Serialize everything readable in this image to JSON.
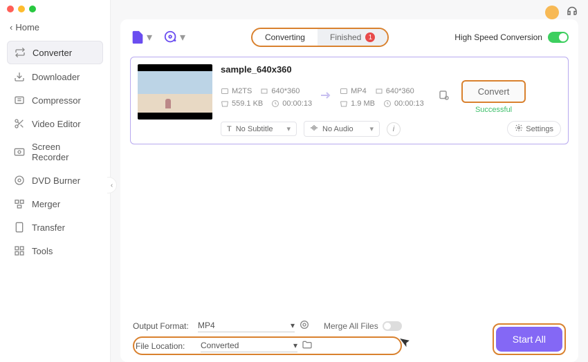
{
  "window": {
    "back_label": "Home"
  },
  "sidebar": {
    "items": [
      {
        "label": "Converter",
        "icon": "convert"
      },
      {
        "label": "Downloader",
        "icon": "download"
      },
      {
        "label": "Compressor",
        "icon": "compress"
      },
      {
        "label": "Video Editor",
        "icon": "scissors"
      },
      {
        "label": "Screen Recorder",
        "icon": "record"
      },
      {
        "label": "DVD Burner",
        "icon": "disc"
      },
      {
        "label": "Merger",
        "icon": "merge"
      },
      {
        "label": "Transfer",
        "icon": "transfer"
      },
      {
        "label": "Tools",
        "icon": "grid"
      }
    ]
  },
  "header": {
    "tabs": {
      "converting": "Converting",
      "finished": "Finished",
      "finished_count": "1"
    },
    "high_speed_label": "High Speed Conversion"
  },
  "item": {
    "filename": "sample_640x360",
    "src": {
      "format": "M2TS",
      "resolution": "640*360",
      "size": "559.1 KB",
      "duration": "00:00:13"
    },
    "dst": {
      "format": "MP4",
      "resolution": "640*360",
      "size": "1.9 MB",
      "duration": "00:00:13"
    },
    "convert_label": "Convert",
    "status": "Successful",
    "subtitle": {
      "label": "No Subtitle"
    },
    "audio": {
      "label": "No Audio"
    },
    "settings_label": "Settings"
  },
  "footer": {
    "output_format_label": "Output Format:",
    "output_format_value": "MP4",
    "file_location_label": "File Location:",
    "file_location_value": "Converted",
    "merge_label": "Merge All Files",
    "start_all_label": "Start All"
  }
}
